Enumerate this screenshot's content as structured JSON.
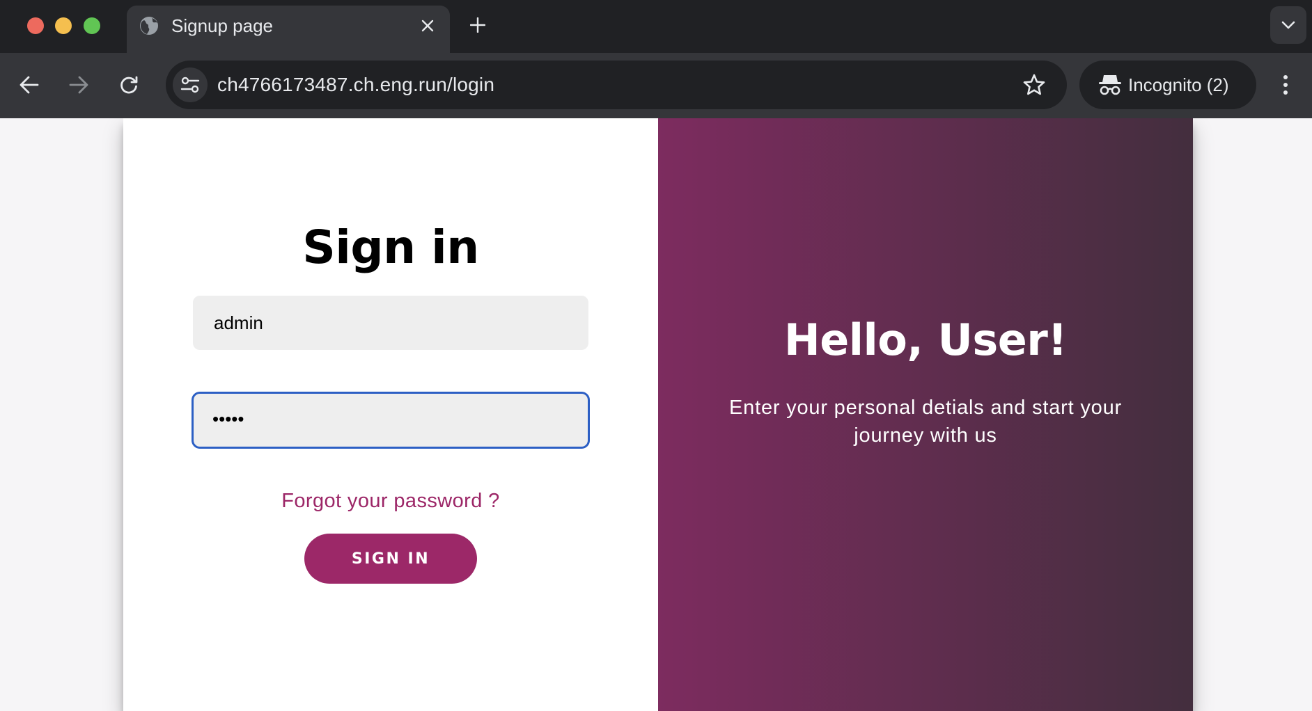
{
  "browser": {
    "tab": {
      "title": "Signup page",
      "favicon": "globe-icon"
    },
    "address": {
      "url": "ch4766173487.ch.eng.run/login"
    },
    "profile": {
      "label": "Incognito (2)"
    },
    "icons": [
      "back-arrow-icon",
      "forward-arrow-icon",
      "reload-icon",
      "site-settings-icon",
      "bookmark-star-icon",
      "incognito-icon",
      "more-menu-icon",
      "close-icon",
      "plus-icon",
      "chevron-down-icon"
    ]
  },
  "signin": {
    "title": "Sign in",
    "username_value": "admin",
    "password_value": "•••••",
    "forgot_label": "Forgot your password ?",
    "button_label": "SIGN IN"
  },
  "overlay": {
    "title": "Hello, User!",
    "subtitle": "Enter your personal detials and start your journey with us"
  },
  "colors": {
    "accent": "#9c2868",
    "gradient_start": "#7d2c5f",
    "gradient_end": "#432e3e",
    "focus_ring": "#2c5fc4"
  }
}
